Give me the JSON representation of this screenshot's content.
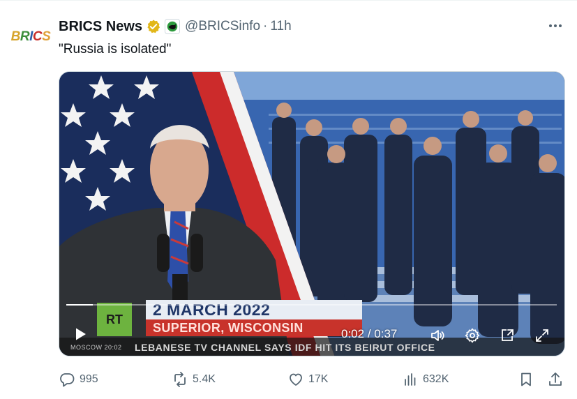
{
  "tweet": {
    "avatar_text": "BRICS",
    "display_name": "BRICS News",
    "handle": "@BRICSinfo",
    "separator": "·",
    "time": "11h",
    "text": "\"Russia is isolated\""
  },
  "video": {
    "date_banner": "2 MARCH 2022",
    "location_banner": "SUPERIOR, WISCONSIN",
    "logo": "RT",
    "ticker_clock": "MOSCOW   20:02",
    "ticker_text": "LEBANESE TV CHANNEL SAYS IDF HIT ITS BEIRUT OFFICE",
    "current_time": "0:02",
    "time_separator": " / ",
    "duration": "0:37",
    "progress_fraction": 0.054
  },
  "actions": {
    "replies": "995",
    "reposts": "5.4K",
    "likes": "17K",
    "views": "632K"
  },
  "icons": {
    "verified": "verified-badge-icon",
    "affiliate": "affiliate-badge-icon",
    "more": "more-icon",
    "play": "play-icon",
    "volume": "volume-icon",
    "settings": "gear-icon",
    "pip": "pip-icon",
    "fullscreen": "fullscreen-icon",
    "reply": "reply-icon",
    "repost": "repost-icon",
    "like": "heart-icon",
    "views": "views-icon",
    "bookmark": "bookmark-icon",
    "share": "share-icon"
  },
  "colors": {
    "text_primary": "#0f1419",
    "text_secondary": "#536471",
    "verified_gold": "#e2b719",
    "rt_green": "#6db33f",
    "location_red": "#c8332b"
  }
}
